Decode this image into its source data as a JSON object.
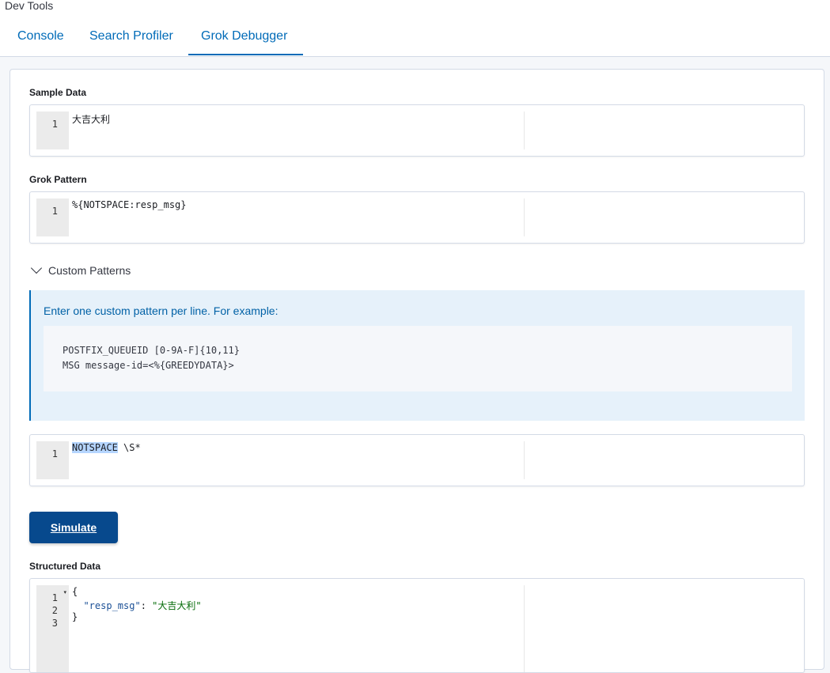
{
  "app": {
    "title": "Dev Tools"
  },
  "tabs": [
    {
      "label": "Console",
      "active": false
    },
    {
      "label": "Search Profiler",
      "active": false
    },
    {
      "label": "Grok Debugger",
      "active": true
    }
  ],
  "sample_data": {
    "label": "Sample Data",
    "line_number": "1",
    "value": "大吉大利"
  },
  "grok_pattern": {
    "label": "Grok Pattern",
    "line_number": "1",
    "value": "%{NOTSPACE:resp_msg}"
  },
  "custom_patterns": {
    "toggle_label": "Custom Patterns",
    "expanded": true,
    "help_text": "Enter one custom pattern per line. For example:",
    "example_lines": [
      "POSTFIX_QUEUEID [0-9A-F]{10,11}",
      "MSG message-id=<%{GREEDYDATA}>"
    ],
    "editor": {
      "line_number": "1",
      "selected_text": "NOTSPACE",
      "rest_text": " \\S*"
    }
  },
  "simulate_button": {
    "label": "Simulate"
  },
  "structured_data": {
    "label": "Structured Data",
    "line_numbers": [
      "1",
      "2",
      "3"
    ],
    "lines": {
      "open_brace": "{",
      "indent": "  ",
      "key": "\"resp_msg\"",
      "colon": ": ",
      "value": "\"大吉大利\"",
      "close_brace": "}"
    }
  },
  "colors": {
    "accent": "#006bb8",
    "button_bg": "#07498d",
    "callout_bg": "#e6f1fa",
    "selection": "#b5d5ff"
  }
}
